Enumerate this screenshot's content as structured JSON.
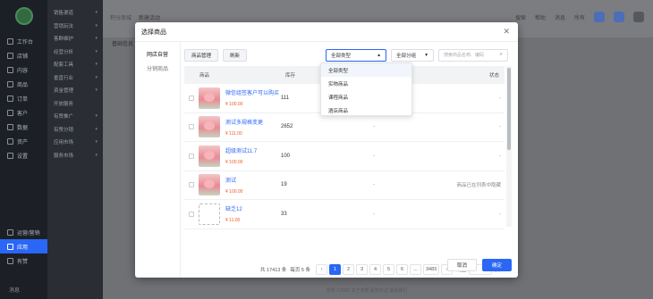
{
  "nav1": {
    "items": [
      {
        "label": "工作台"
      },
      {
        "label": "店铺"
      },
      {
        "label": "内容"
      },
      {
        "label": "商品"
      },
      {
        "label": "订单"
      },
      {
        "label": "客户"
      },
      {
        "label": "数据"
      },
      {
        "label": "资产"
      },
      {
        "label": "设置"
      }
    ],
    "lower": [
      {
        "label": "运营/营销"
      },
      {
        "label": "应用"
      },
      {
        "label": "有赞"
      }
    ],
    "active_label": "应用",
    "bottom_label": "消息"
  },
  "nav2": {
    "items": [
      "销售渠道",
      "营销玩法",
      "客群维护",
      "经营分析",
      "配套工具",
      "垂直行业",
      "资金管理",
      "开放服务",
      "有赞推广",
      "有赞分销",
      "应用市场",
      "服务市场"
    ]
  },
  "topbar": {
    "crumb": "积分商城",
    "crumb2": "新建活动",
    "tools": [
      "搜索",
      "帮助",
      "消息",
      "所有"
    ]
  },
  "main": {
    "section_title": "基础信息",
    "footer": "有赞 ©2022  关于有赞  服务协议  联系我们"
  },
  "modal": {
    "title": "选择商品",
    "tabs": [
      "网店自营",
      "分销商品"
    ],
    "toolbar": {
      "manage_label": "商品管理",
      "refresh_label": "刷新",
      "type_select": "全部类型",
      "group_select": "全部分组",
      "search_placeholder": "搜索商品名称、编码"
    },
    "dropdown_options": [
      "全部类型",
      "实物商品",
      "课程商品",
      "酒店商品"
    ],
    "columns": {
      "product": "商品",
      "stock": "库存",
      "status": "状态"
    },
    "rows": [
      {
        "name": "微信组签客户可以购买",
        "price": "¥ 100.00",
        "stock": "111",
        "dash": "-",
        "status": "-",
        "thumb": "photo"
      },
      {
        "name": "测试多规格变更",
        "price": "¥ 111.00",
        "stock": "2652",
        "dash": "-",
        "status": "-",
        "thumb": "photo"
      },
      {
        "name": "超级测试11.7",
        "price": "¥ 100.00",
        "stock": "100",
        "dash": "-",
        "status": "-",
        "thumb": "photo"
      },
      {
        "name": "测试",
        "price": "¥ 100.00",
        "stock": "19",
        "dash": "-",
        "status": "商品已在列表中隐藏",
        "thumb": "photo"
      },
      {
        "name": "缺乏12",
        "price": "¥ 11.00",
        "stock": "33",
        "dash": "-",
        "status": "-",
        "thumb": "qr"
      }
    ],
    "pager": {
      "total": "共 17413 条",
      "per_page": "每页 5 条",
      "prev": "‹",
      "pages": [
        "1",
        "2",
        "3",
        "4",
        "5",
        "6",
        "...",
        "3483"
      ],
      "current": "1",
      "next": "›",
      "jump": "跳至",
      "jump_suffix": "页"
    },
    "cancel_label": "取消",
    "ok_label": "确定"
  }
}
